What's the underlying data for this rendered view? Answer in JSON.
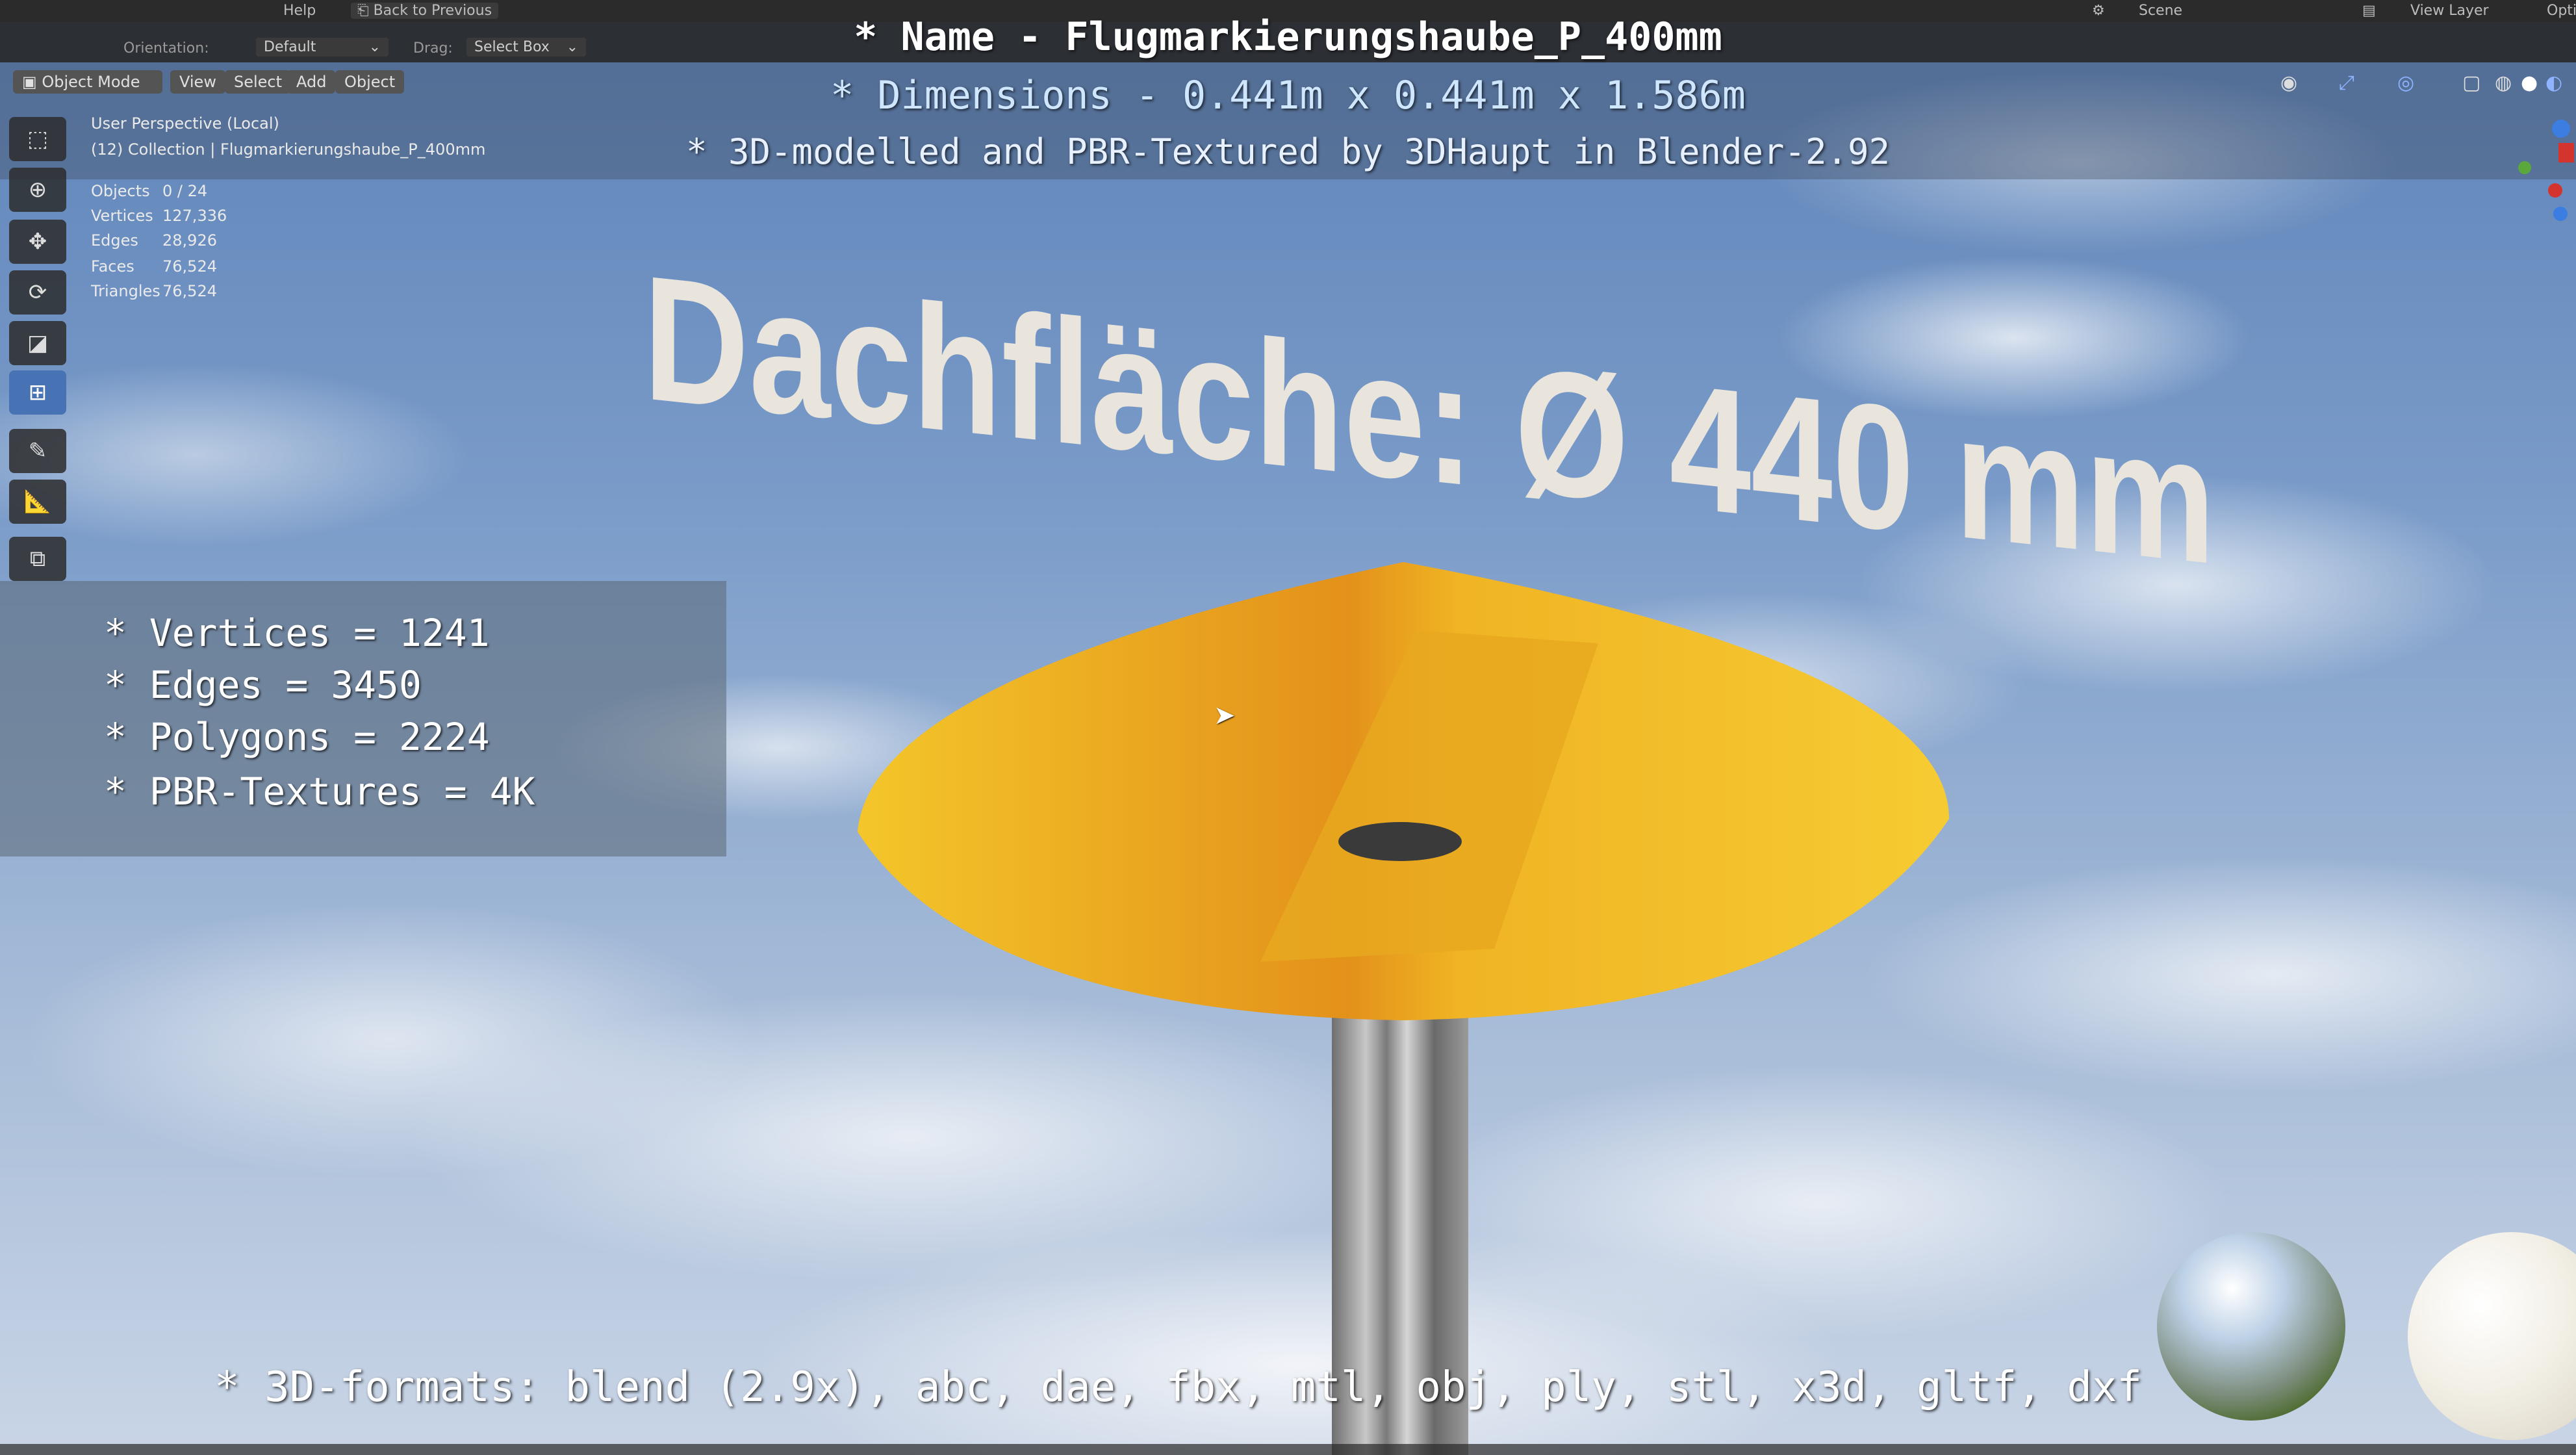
{
  "topbar": {
    "menu_help": "Help",
    "back_button": "Back to Previous",
    "scene_label": "Scene",
    "view_layer_label": "View Layer",
    "options_label": "Opti"
  },
  "toolbar": {
    "orientation_label": "Orientation:",
    "orientation_value": "Default",
    "drag_label": "Drag:",
    "drag_value": "Select Box"
  },
  "header": {
    "mode": "Object Mode",
    "menus": [
      "View",
      "Select",
      "Add",
      "Object"
    ]
  },
  "viewport": {
    "perspective": "User Perspective (Local)",
    "collection": "(12) Collection | Flugmarkierungshaube_P_400mm",
    "stats": [
      {
        "label": "Objects",
        "value": "0 / 24"
      },
      {
        "label": "Vertices",
        "value": "127,336"
      },
      {
        "label": "Edges",
        "value": "28,926"
      },
      {
        "label": "Faces",
        "value": "76,524"
      },
      {
        "label": "Triangles",
        "value": "76,524"
      }
    ]
  },
  "overlay": {
    "name_line": "* Name - Flugmarkierungshaube_P_400mm",
    "dimensions_line": "* Dimensions -  0.441m x 0.441m x 1.586m",
    "credit_line": "* 3D-modelled and PBR-Textured by 3DHaupt in Blender-2.92",
    "info_lines": [
      "* Vertices = 1241",
      "* Edges = 3450",
      "* Polygons = 2224",
      "* PBR-Textures = 4K"
    ],
    "scene_text": "Dachfläche:  Ø 440 mm",
    "formats_line": "* 3D-formats: blend (2.9x), abc, dae, fbx, mtl, obj, ply, stl, x3d, gltf, dxf"
  },
  "colors": {
    "hood_yellow": "#f0c020",
    "hood_shadow": "#d88a14",
    "active_tool": "#4772b3"
  }
}
